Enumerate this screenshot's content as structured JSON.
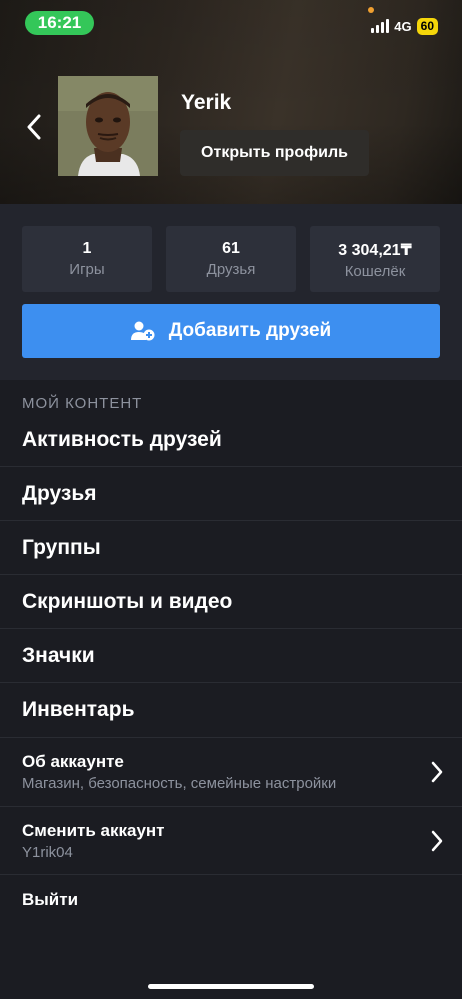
{
  "status_bar": {
    "time": "16:21",
    "network": "4G",
    "battery": "60"
  },
  "profile": {
    "name": "Yerik",
    "open_profile_label": "Открыть профиль"
  },
  "stats": [
    {
      "value": "1",
      "label": "Игры"
    },
    {
      "value": "61",
      "label": "Друзья"
    },
    {
      "value": "3 304,21₸",
      "label": "Кошелёк"
    }
  ],
  "add_friends_label": "Добавить друзей",
  "content_section": {
    "title": "МОЙ КОНТЕНТ",
    "items": [
      "Активность друзей",
      "Друзья",
      "Группы",
      "Скриншоты и видео",
      "Значки",
      "Инвентарь"
    ]
  },
  "account": {
    "title": "Об аккаунте",
    "subtitle": "Магазин, безопасность, семейные настройки"
  },
  "switch_account": {
    "title": "Сменить аккаунт",
    "subtitle": "Y1rik04"
  },
  "logout_label": "Выйти",
  "colors": {
    "accent": "#3d8ff0",
    "background": "#1b1c22",
    "card": "#2d303a",
    "muted_text": "#8d929e",
    "time_pill": "#34c759",
    "battery": "#f5d60a"
  }
}
